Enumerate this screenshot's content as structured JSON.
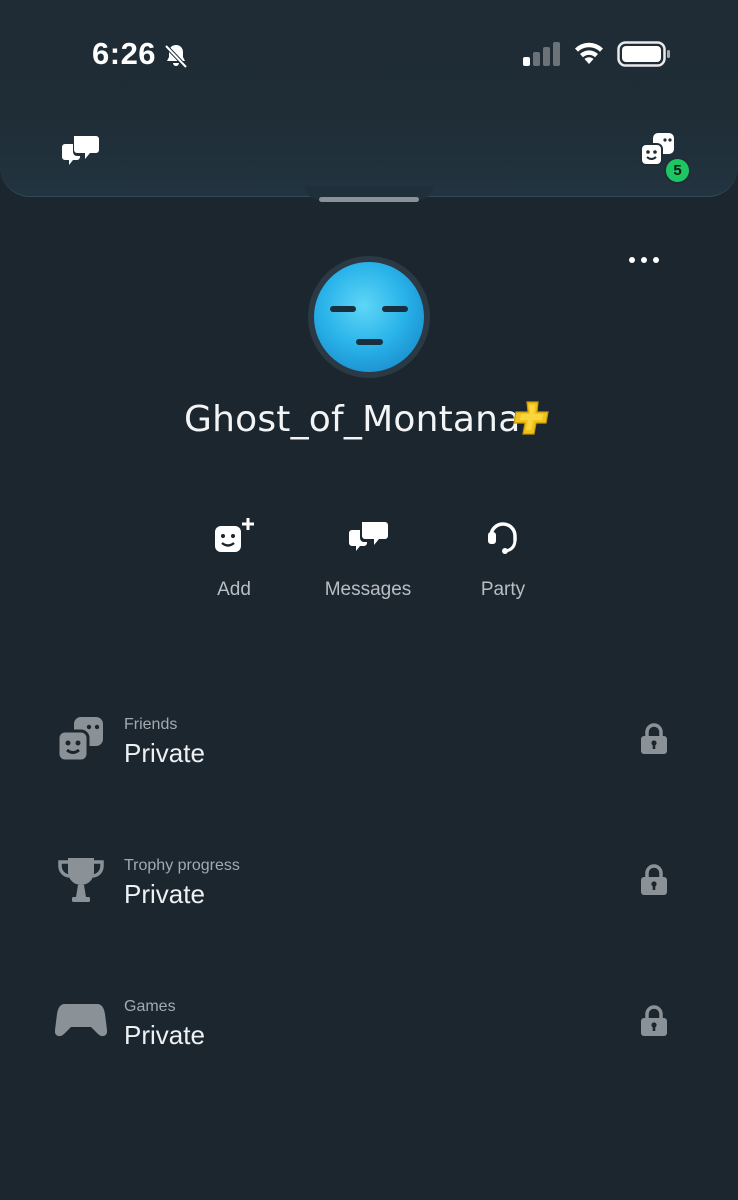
{
  "status_bar": {
    "time": "6:26",
    "icons": [
      "bell-slash-icon",
      "signal-icon",
      "wifi-icon",
      "battery-icon"
    ]
  },
  "header": {
    "left_icon": "chat-bubbles-icon",
    "right_icon": "friends-icon",
    "friends_badge": "5"
  },
  "profile": {
    "more_icon": "more-dots-icon",
    "avatar_icon": "expressionless-face-avatar",
    "username": "Ghost_of_Montana",
    "plus_icon": "ps-plus-icon"
  },
  "actions": [
    {
      "label": "Add",
      "icon": "add-friend-icon"
    },
    {
      "label": "Messages",
      "icon": "messages-icon"
    },
    {
      "label": "Party",
      "icon": "headset-icon"
    }
  ],
  "privacy_rows": [
    {
      "title": "Friends",
      "value": "Private",
      "icon": "friends-icon"
    },
    {
      "title": "Trophy progress",
      "value": "Private",
      "icon": "trophy-icon"
    },
    {
      "title": "Games",
      "value": "Private",
      "icon": "gamepad-icon"
    }
  ],
  "colors": {
    "background": "#1b262f",
    "badge": "#1ec663",
    "plus_gold": "#f2c318",
    "avatar_blue": "#2ab4ea"
  }
}
